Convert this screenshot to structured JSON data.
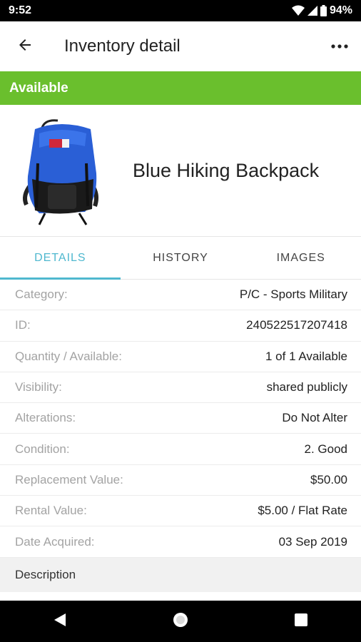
{
  "status_bar": {
    "time": "9:52",
    "battery": "94%",
    "icons": [
      "wifi-icon",
      "signal-icon",
      "battery-icon"
    ]
  },
  "app_bar": {
    "title": "Inventory detail",
    "back_icon": "arrow-left-icon",
    "menu_icon": "more-horizontal-icon"
  },
  "status_banner": {
    "label": "Available",
    "color": "#6abf2d"
  },
  "product": {
    "name": "Blue Hiking Backpack",
    "image": "blue-backpack-photo"
  },
  "tabs": [
    {
      "label": "DETAILS",
      "active": true
    },
    {
      "label": "HISTORY",
      "active": false
    },
    {
      "label": "IMAGES",
      "active": false
    }
  ],
  "accent_color": "#4fb8cf",
  "details": [
    {
      "label": "Category:",
      "value": "P/C - Sports Military"
    },
    {
      "label": "ID:",
      "value": "240522517207418"
    },
    {
      "label": "Quantity / Available:",
      "value": "1 of 1 Available"
    },
    {
      "label": "Visibility:",
      "value": "shared publicly"
    },
    {
      "label": "Alterations:",
      "value": "Do Not Alter"
    },
    {
      "label": "Condition:",
      "value": "2. Good"
    },
    {
      "label": "Replacement Value:",
      "value": "$50.00"
    },
    {
      "label": "Rental Value:",
      "value": "$5.00 / Flat Rate"
    },
    {
      "label": "Date Acquired:",
      "value": "03 Sep 2019"
    }
  ],
  "description_header": "Description",
  "nav_bar": {
    "icons": [
      "nav-back-icon",
      "nav-home-icon",
      "nav-recents-icon"
    ]
  }
}
